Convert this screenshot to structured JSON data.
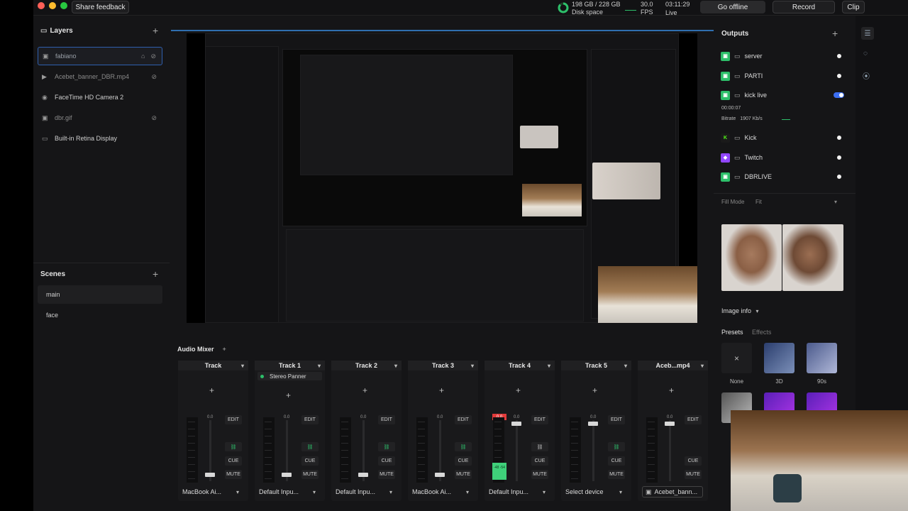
{
  "topbar": {
    "share_feedback": "Share feedback",
    "disk_value": "198 GB / 228 GB",
    "disk_label": "Disk space",
    "fps_value": "30.0",
    "fps_label": "FPS",
    "time_value": "03:11:29",
    "time_label": "Live",
    "go_offline": "Go offline",
    "record": "Record",
    "clip": "Clip"
  },
  "layers": {
    "title": "Layers",
    "items": [
      {
        "label": "fabiano"
      },
      {
        "label": "Acebet_banner_DBR.mp4"
      },
      {
        "label": "FaceTime HD Camera 2"
      },
      {
        "label": "dbr.gif"
      },
      {
        "label": "Built-in Retina Display"
      }
    ]
  },
  "scenes": {
    "title": "Scenes",
    "items": [
      {
        "label": "main"
      },
      {
        "label": "face"
      }
    ]
  },
  "mixer": {
    "title": "Audio Mixer",
    "tracks": [
      {
        "name": "Track",
        "device": "MacBook Ai...",
        "db": "0.0"
      },
      {
        "name": "Track 1",
        "device": "Default Inpu...",
        "db": "0.0",
        "panner": "Stereo Panner"
      },
      {
        "name": "Track 2",
        "device": "Default Inpu...",
        "db": "0.0"
      },
      {
        "name": "Track 3",
        "device": "MacBook Ai...",
        "db": "0.0"
      },
      {
        "name": "Track 4",
        "device": "Default Inpu...",
        "db": "0.0",
        "peak": "0.0",
        "level": "-48 -54"
      },
      {
        "name": "Track 5",
        "device": "Select device",
        "db": "0.0"
      },
      {
        "name": "Aceb...mp4",
        "device": "Acebet_bann...",
        "db": "0.0"
      }
    ],
    "edit": "EDIT",
    "cue": "CUE",
    "mute": "MUTE"
  },
  "outputs": {
    "title": "Outputs",
    "items": [
      {
        "label": "server"
      },
      {
        "label": "PARTI"
      },
      {
        "label": "kick live"
      },
      {
        "label": "Kick"
      },
      {
        "label": "Twitch"
      },
      {
        "label": "DBRLIVE"
      }
    ],
    "kick_live_time": "00:00:07",
    "bitrate_label": "Bitrate",
    "bitrate_value": "1907 Kb/s",
    "fill_mode_label": "Fill Mode",
    "fill_mode_value": "Fit",
    "image_info": "Image info",
    "presets_tab": "Presets",
    "effects_tab": "Effects",
    "presets": [
      {
        "label": "None"
      },
      {
        "label": "3D"
      },
      {
        "label": "90s"
      }
    ]
  },
  "colors": {
    "accent": "#3b6ef2",
    "live_green": "#2dbf6a",
    "meter_red": "#e23b3b"
  }
}
